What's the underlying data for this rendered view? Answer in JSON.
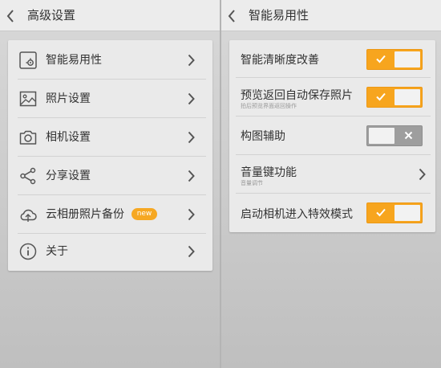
{
  "left": {
    "header": {
      "title": "高级设置",
      "back_icon": "chevron-left-icon"
    },
    "items": [
      {
        "label": "智能易用性",
        "icon": "smart-settings-icon"
      },
      {
        "label": "照片设置",
        "icon": "image-icon"
      },
      {
        "label": "相机设置",
        "icon": "camera-icon"
      },
      {
        "label": "分享设置",
        "icon": "share-icon"
      },
      {
        "label": "云相册照片备份",
        "icon": "cloud-backup-icon",
        "badge": "new"
      },
      {
        "label": "关于",
        "icon": "info-icon"
      }
    ]
  },
  "right": {
    "header": {
      "title": "智能易用性",
      "back_icon": "chevron-left-icon"
    },
    "items": [
      {
        "label": "智能清晰度改善",
        "toggle": "on"
      },
      {
        "label": "预览返回自动保存照片",
        "sub": "拍后预览界面返回操作",
        "toggle": "on"
      },
      {
        "label": "构图辅助",
        "toggle": "off"
      },
      {
        "label": "音量键功能",
        "sub": "音量调节",
        "control": "chevron"
      },
      {
        "label": "启动相机进入特效模式",
        "toggle": "on"
      }
    ]
  },
  "colors": {
    "accent": "#f7a51e",
    "toggle_off": "#9e9e9e",
    "card_bg": "#eaeaea",
    "header_bg": "#ececec"
  }
}
